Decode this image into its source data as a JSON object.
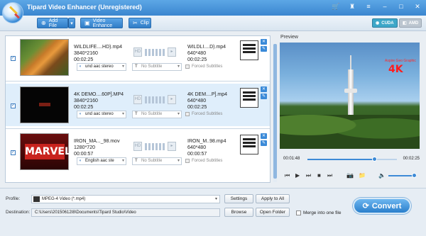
{
  "window": {
    "title": "Tipard Video Enhancer (Unregistered)"
  },
  "titlebar_icons": [
    "cart-icon",
    "user-icon",
    "menu-icon",
    "minimize-icon",
    "maximize-icon",
    "close-icon"
  ],
  "toolbar": {
    "add_file": "Add File",
    "video_enhance": "Video Enhance",
    "clip": "Clip",
    "gpu_cuda": "CUDA",
    "gpu_amd": "AMD"
  },
  "files": [
    {
      "src_name": "WILDLIFE....HD).mp4",
      "src_res": "3840*2160",
      "src_dur": "00:02:25",
      "dst_name": "WILDLI....D).mp4",
      "dst_res": "640*480",
      "dst_dur": "00:02:25",
      "audio": "und aac stereo",
      "subtitle": "No Subtitle",
      "forced": "Forced Subtitles",
      "thumb": "tiger",
      "selected": false
    },
    {
      "src_name": "4K DEMO....60P].MP4",
      "src_res": "3840*2160",
      "src_dur": "00:02:25",
      "dst_name": "4K DEM....P].mp4",
      "dst_res": "640*480",
      "dst_dur": "00:02:25",
      "audio": "und aac stereo",
      "subtitle": "No Subtitle",
      "forced": "Forced Subtitles",
      "thumb": "dark",
      "selected": true
    },
    {
      "src_name": "IRON_MA..._98.mov",
      "src_res": "1280*720",
      "src_dur": "00:00:57",
      "dst_name": "IRON_M..98.mp4",
      "dst_res": "640*480",
      "dst_dur": "00:00:57",
      "audio": "English aac ste",
      "subtitle": "No Subtitle",
      "forced": "Forced Subtitles",
      "thumb": "marvel",
      "selected": false,
      "thumb_text": "MARVEL"
    }
  ],
  "preview": {
    "label": "Preview",
    "brand_small": "Aspire Geo Graphic",
    "brand_4k": "4K",
    "time_current": "00:01:48",
    "time_total": "00:02:25",
    "progress": 0.745,
    "volume": 0.9
  },
  "bottom": {
    "profile_label": "Profile:",
    "profile_value": "MPEG-4 Video (*.mp4)",
    "settings": "Settings",
    "apply_all": "Apply to All",
    "destination_label": "Destination:",
    "destination_value": "C:\\Users\\20150612I8\\Documents\\Tipard Studio\\Video",
    "browse": "Browse",
    "open_folder": "Open Folder",
    "merge": "Merge into one file",
    "convert": "Convert"
  }
}
